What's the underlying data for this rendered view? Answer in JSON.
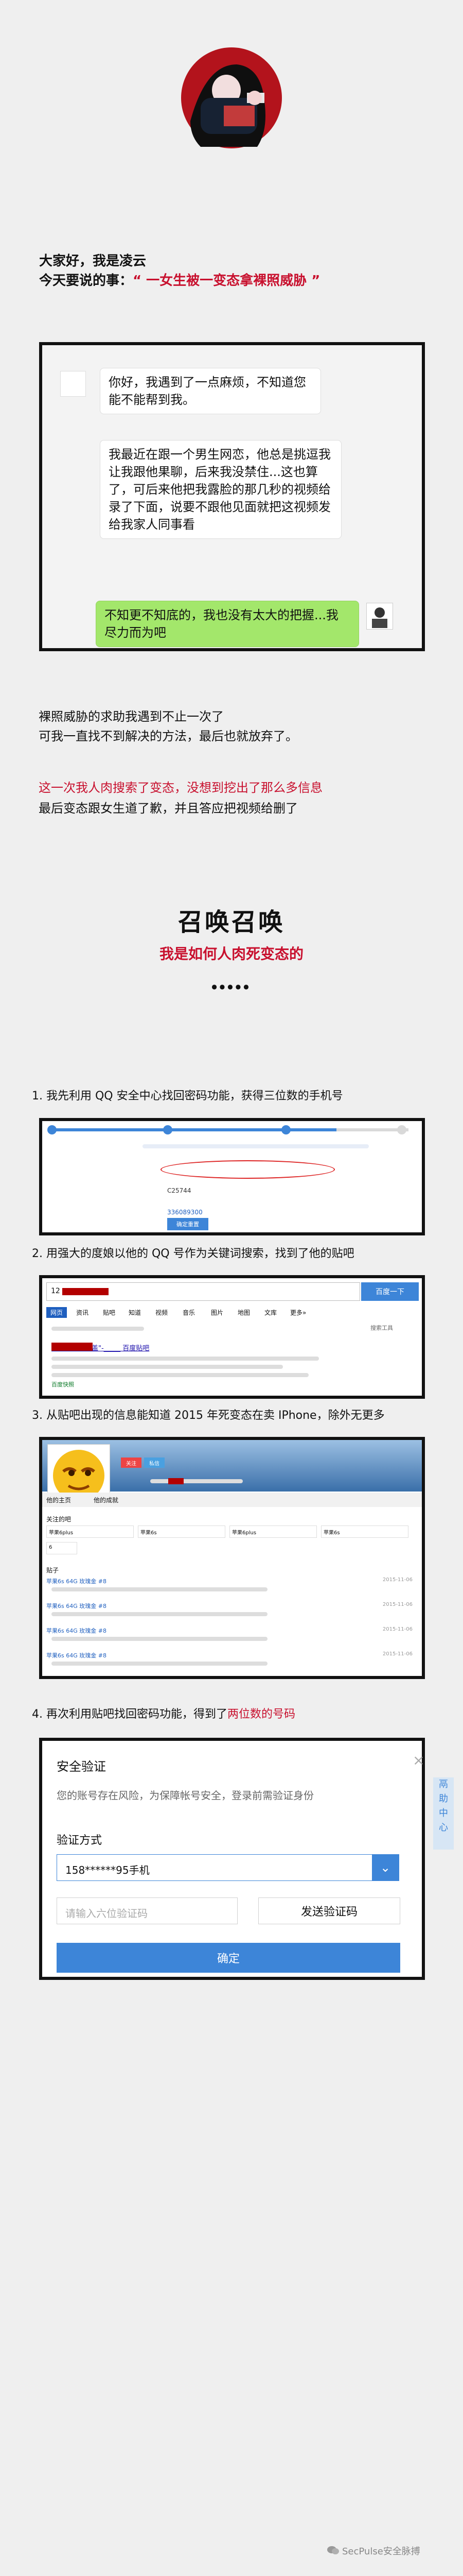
{
  "intro": {
    "line1": "大家好，我是凌云",
    "line2_prefix": "今天要说的事：",
    "line2_highlight": "“ 一女生被一变态拿裸照威胁 ”"
  },
  "chat": {
    "messages": [
      {
        "side": "left",
        "text": "你好，我遇到了一点麻烦，不知道您能不能帮到我。"
      },
      {
        "side": "left",
        "text": "我最近在跟一个男生网恋，他总是挑逗我让我跟他果聊，后来我没禁住...这也算了，可后来他把我露脸的那几秒的视频给录了下面，说要不跟他见面就把这视频发给我家人同事看"
      },
      {
        "side": "right",
        "text": "不知更不知底的，我也没有太大的把握...我尽力而为吧"
      }
    ]
  },
  "story": {
    "p1": "裸照威胁的求助我遇到不止一次了",
    "p2": "可我一直找不到解决的方法，最后也就放弃了。",
    "p3": "这一次我人肉搜索了变态，没想到挖出了那么多信息",
    "p4": "最后变态跟女生道了歉，并且答应把视频给删了"
  },
  "section": {
    "title": "召唤召唤",
    "subtitle": "我是如何人肉死变态的",
    "dots": "●●●●●"
  },
  "steps": {
    "s1": "1. 我先利用 QQ 安全中心找回密码功能，获得三位数的手机号",
    "s2": "2. 用强大的度娘以他的 QQ 号作为关键词搜索，找到了他的贴吧",
    "s3": "3. 从贴吧出现的信息能知道 2015 年死变态在卖 IPhone，除外无更多",
    "s4_prefix": "4. 再次利用贴吧找回密码功能，得到了",
    "s4_highlight": "两位数的号码"
  },
  "shot1": {
    "code": "C25744",
    "link": "336089300",
    "button": "确定重置"
  },
  "shot2": {
    "query": "12",
    "button": "百度一下",
    "tabs": [
      "网页",
      "资讯",
      "贴吧",
      "知道",
      "视频",
      "音乐",
      "图片",
      "地图",
      "文库",
      "更多»"
    ],
    "tools": "搜索工具",
    "result_title": "去希到很的欧盖\"-_____ 百度贴吧",
    "footer": "百度快照"
  },
  "shot3": {
    "follow": "关注",
    "btn": "私信",
    "tab_home": "他的主页",
    "tab_achieve": "他的成就",
    "section_bars": "关注的吧",
    "section_posts": "贴子",
    "bars": [
      "苹果6plus",
      "苹果6s",
      "苹果6plus",
      "苹果6s"
    ],
    "bar2": "6",
    "posts": [
      {
        "title": "苹果6s 64G 玫瑰金 #8",
        "date": "2015-11-06"
      },
      {
        "title": "苹果6s 64G 玫瑰金 #8",
        "date": "2015-11-06"
      },
      {
        "title": "苹果6s 64G 玫瑰金 #8",
        "date": "2015-11-06"
      },
      {
        "title": "苹果6s 64G 玫瑰金 #8",
        "date": "2015-11-06"
      }
    ]
  },
  "shot4": {
    "title": "安全验证",
    "desc": "您的账号存在风险，为保障帐号安全，登录前需验证身份",
    "method_label": "验证方式",
    "method_value": "158******95手机",
    "code_placeholder": "请输入六位验证码",
    "send": "发送验证码",
    "confirm": "确定",
    "side_text": "鬲 助 中 心"
  },
  "watermark": "SecPulse安全脉搏",
  "colors": {
    "red": "#c8102e",
    "blue": "#3d85d8",
    "green": "#a3e76b",
    "box_border": "#111111"
  }
}
